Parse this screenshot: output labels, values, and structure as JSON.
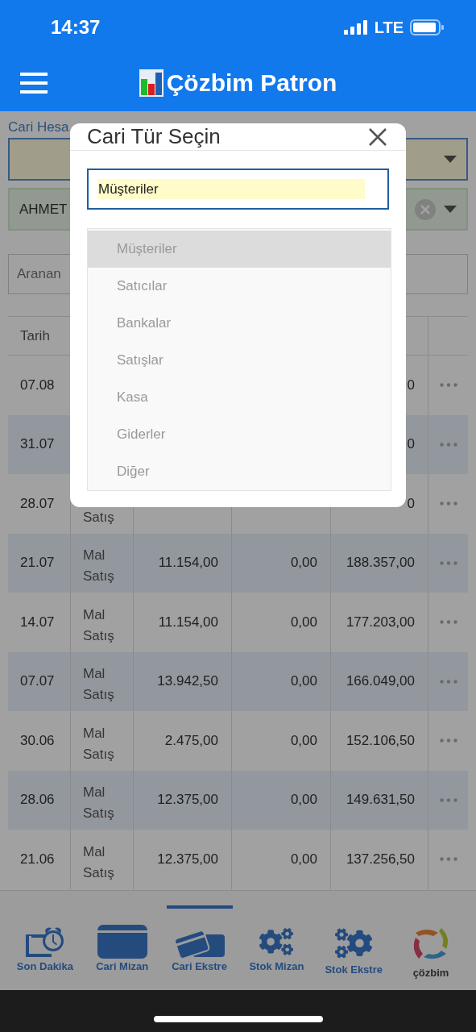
{
  "status_bar": {
    "time": "14:37",
    "network": "LTE"
  },
  "header": {
    "title": "Çözbim Patron"
  },
  "filter": {
    "label": "Cari Hesa",
    "account": {
      "value": "AHMET"
    },
    "search": {
      "placeholder": "Aranan"
    }
  },
  "table": {
    "columns": [
      "Tarih"
    ],
    "rows": [
      {
        "date": "07.08",
        "balance": "0"
      },
      {
        "date": "31.07",
        "balance": "0"
      },
      {
        "date": "28.07",
        "type_lines": [
          "Satış"
        ],
        "balance": "0"
      },
      {
        "date": "21.07",
        "type_lines": [
          "Mal",
          "Satış"
        ],
        "debit": "11.154,00",
        "credit": "0,00",
        "balance": "188.357,00"
      },
      {
        "date": "14.07",
        "type_lines": [
          "Mal",
          "Satış"
        ],
        "debit": "11.154,00",
        "credit": "0,00",
        "balance": "177.203,00"
      },
      {
        "date": "07.07",
        "type_lines": [
          "Mal",
          "Satış"
        ],
        "debit": "13.942,50",
        "credit": "0,00",
        "balance": "166.049,00"
      },
      {
        "date": "30.06",
        "type_lines": [
          "Mal",
          "Satış"
        ],
        "debit": "2.475,00",
        "credit": "0,00",
        "balance": "152.106,50"
      },
      {
        "date": "28.06",
        "type_lines": [
          "Mal",
          "Satış"
        ],
        "debit": "12.375,00",
        "credit": "0,00",
        "balance": "149.631,50"
      },
      {
        "date": "21.06",
        "type_lines": [
          "Mal",
          "Satış"
        ],
        "debit": "12.375,00",
        "credit": "0,00",
        "balance": "137.256,50"
      }
    ]
  },
  "modal": {
    "title": "Cari Tür Seçin",
    "input": {
      "value": "Müşteriler"
    },
    "options": [
      {
        "label": "Müşteriler",
        "selected": true
      },
      {
        "label": "Satıcılar",
        "selected": false
      },
      {
        "label": "Bankalar",
        "selected": false
      },
      {
        "label": "Satışlar",
        "selected": false
      },
      {
        "label": "Kasa",
        "selected": false
      },
      {
        "label": "Giderler",
        "selected": false
      },
      {
        "label": "Diğer",
        "selected": false
      }
    ]
  },
  "bottom_nav": [
    {
      "kind": "alarm",
      "label": "Son Dakika",
      "selected": false
    },
    {
      "kind": "card",
      "label": "Cari Mizan",
      "selected": false
    },
    {
      "kind": "cards",
      "label": "Cari Ekstre",
      "selected": true
    },
    {
      "kind": "gears",
      "label": "Stok Mizan",
      "selected": false
    },
    {
      "kind": "gears3",
      "label": "Stok Ekstre",
      "selected": false
    },
    {
      "kind": "logo",
      "label": "çözbim",
      "selected": false
    }
  ]
}
